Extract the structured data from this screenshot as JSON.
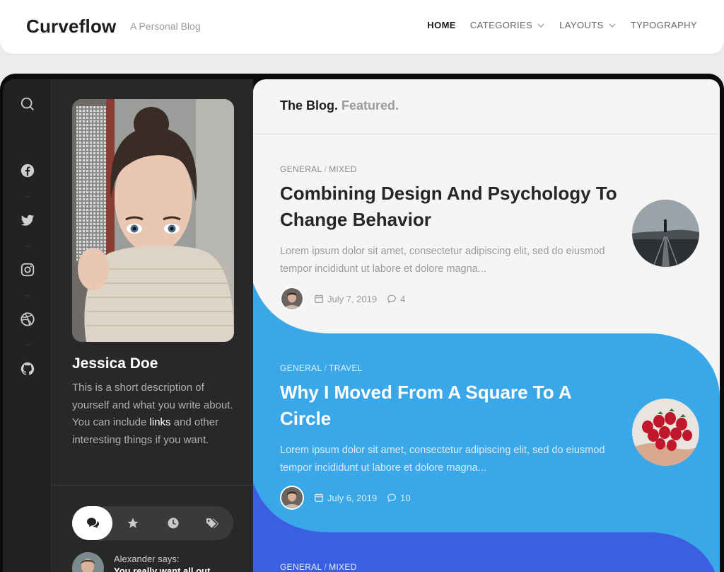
{
  "header": {
    "logo": "Curveflow",
    "tagline": "A Personal Blog",
    "nav": [
      {
        "label": "HOME",
        "active": true,
        "has_dropdown": false
      },
      {
        "label": "CATEGORIES",
        "active": false,
        "has_dropdown": true
      },
      {
        "label": "LAYOUTS",
        "active": false,
        "has_dropdown": true
      },
      {
        "label": "TYPOGRAPHY",
        "active": false,
        "has_dropdown": false
      }
    ]
  },
  "sidebar_icons": [
    "search-icon",
    "facebook-icon",
    "twitter-icon",
    "instagram-icon",
    "dribbble-icon",
    "github-icon"
  ],
  "profile": {
    "name": "Jessica Doe",
    "desc_before": "This is a short description of yourself and what you write about. You can include ",
    "desc_link": "links",
    "desc_after": " and other interesting things if you want.",
    "tabs": [
      {
        "icon": "comments-icon",
        "active": true
      },
      {
        "icon": "star-icon",
        "active": false
      },
      {
        "icon": "clock-icon",
        "active": false
      },
      {
        "icon": "tags-icon",
        "active": false
      }
    ],
    "comment": {
      "author": "Alexander says:",
      "text": "You really want all out"
    }
  },
  "content": {
    "heading": "The Blog.",
    "subheading": "Featured.",
    "posts": [
      {
        "cat1": "GENERAL",
        "cat2": "MIXED",
        "title": "Combining Design And Psychology To Change Behavior",
        "excerpt": "Lorem ipsum dolor sit amet, consectetur adipiscing elit, sed do eiusmod tempor incididunt ut labore et dolore magna...",
        "date": "July 7, 2019",
        "comments": "4"
      },
      {
        "cat1": "GENERAL",
        "cat2": "TRAVEL",
        "title": "Why I Moved From A Square To A Circle",
        "excerpt": "Lorem ipsum dolor sit amet, consectetur adipiscing elit, sed do eiusmod tempor incididunt ut labore et dolore magna...",
        "date": "July 6, 2019",
        "comments": "10"
      },
      {
        "cat1": "GENERAL",
        "cat2": "MIXED"
      }
    ]
  },
  "colors": {
    "accent_blue": "#3aa7e8",
    "accent_indigo": "#3b5fe0",
    "dark": "#282828"
  }
}
